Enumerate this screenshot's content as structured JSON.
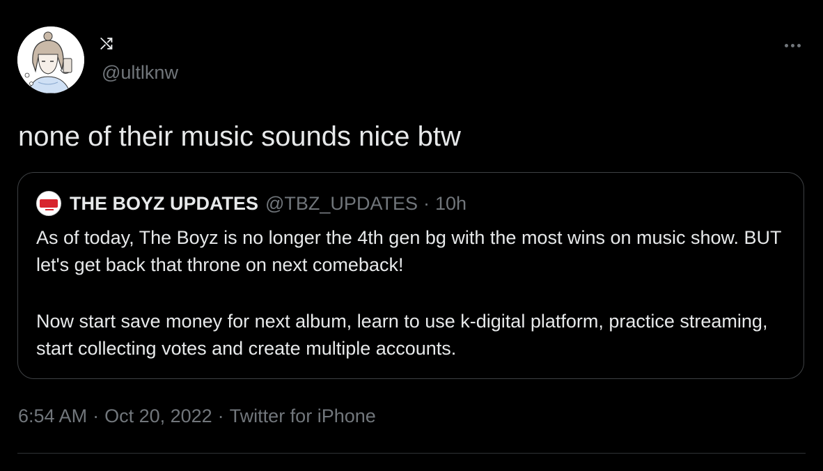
{
  "author": {
    "display_name": "⤭",
    "handle": "@ultlknw"
  },
  "tweet": {
    "text": "none of their music sounds nice btw"
  },
  "quoted_tweet": {
    "author_name": "THE BOYZ UPDATES",
    "author_handle": "@TBZ_UPDATES",
    "separator": "·",
    "time": "10h",
    "paragraphs": [
      "As of today, The Boyz is no longer the 4th gen bg with the most wins on music show. BUT let's get back that throne on next comeback!",
      "Now start save money for next album, learn to use k-digital platform, practice streaming, start collecting votes and create multiple accounts."
    ]
  },
  "meta": {
    "time": "6:54 AM",
    "separator": "·",
    "date": "Oct 20, 2022",
    "source": "Twitter for iPhone"
  },
  "icons": {
    "more": "more-horizontal-icon",
    "author_avatar": "avatar-illustration",
    "quoted_avatar": "the-boyz-logo"
  },
  "colors": {
    "background": "#000000",
    "primary_text": "#e7e9ea",
    "secondary_text": "#71767b",
    "border": "#3e4144"
  }
}
